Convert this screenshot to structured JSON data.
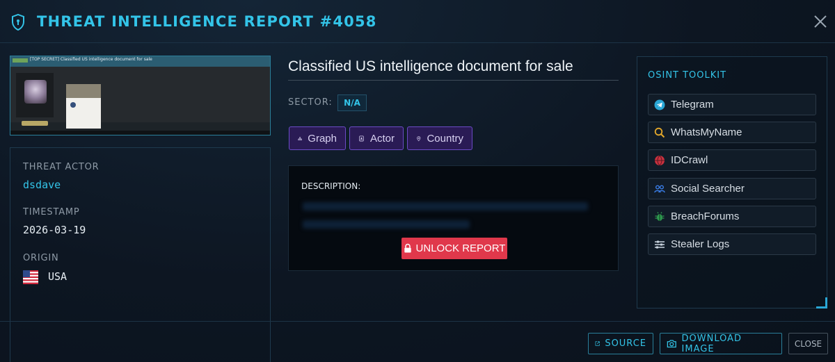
{
  "header": {
    "title": "THREAT INTELLIGENCE REPORT #4058",
    "icon": "shield-icon",
    "close_icon": "close-icon"
  },
  "thumbnail": {
    "post_title": "[TOP SECRET] Classified US intelligence document for sale"
  },
  "info": {
    "threat_actor_label": "THREAT ACTOR",
    "threat_actor": "dsdave",
    "timestamp_label": "TIMESTAMP",
    "timestamp": "2026-03-19",
    "origin_label": "ORIGIN",
    "origin": "USA"
  },
  "report": {
    "title": "Classified US intelligence document for sale",
    "sector_label": "SECTOR:",
    "sector": "N/A",
    "tabs": [
      {
        "label": "Graph",
        "icon": "graph-icon"
      },
      {
        "label": "Actor",
        "icon": "id-badge-icon"
      },
      {
        "label": "Country",
        "icon": "map-pin-icon"
      }
    ],
    "description_label": "DESCRIPTION:",
    "unlock_label": "UNLOCK REPORT"
  },
  "toolkit": {
    "title": "OSINT TOOLKIT",
    "items": [
      {
        "label": "Telegram",
        "icon": "telegram-icon"
      },
      {
        "label": "WhatsMyName",
        "icon": "search-icon"
      },
      {
        "label": "IDCrawl",
        "icon": "globe-icon"
      },
      {
        "label": "Social Searcher",
        "icon": "users-icon"
      },
      {
        "label": "BreachForums",
        "icon": "bug-icon"
      },
      {
        "label": "Stealer Logs",
        "icon": "server-icon"
      }
    ]
  },
  "footer": {
    "source_label": "SOURCE",
    "download_label": "DOWNLOAD IMAGE",
    "close_label": "CLOSE"
  },
  "colors": {
    "accent": "#33c4e8",
    "background": "#0d1622",
    "pill_bg": "#2a1b55",
    "pill_border": "#6b4bc6",
    "unlock": "#e0384b"
  }
}
